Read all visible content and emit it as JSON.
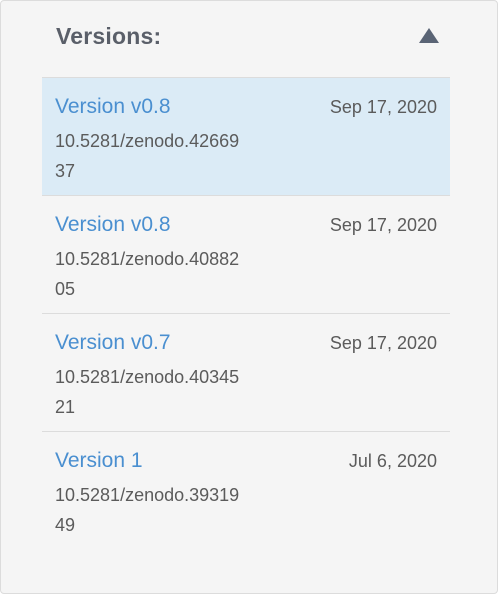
{
  "header": {
    "title": "Versions:",
    "toggle_icon": "triangle-up-icon"
  },
  "versions": [
    {
      "label": "Version v0.8",
      "date": "Sep 17, 2020",
      "doi": "10.5281/zenodo.4266937",
      "selected": true
    },
    {
      "label": "Version v0.8",
      "date": "Sep 17, 2020",
      "doi": "10.5281/zenodo.4088205",
      "selected": false
    },
    {
      "label": "Version v0.7",
      "date": "Sep 17, 2020",
      "doi": "10.5281/zenodo.4034521",
      "selected": false
    },
    {
      "label": "Version 1",
      "date": "Jul 6, 2020",
      "doi": "10.5281/zenodo.3931949",
      "selected": false
    }
  ],
  "colors": {
    "panel_bg": "#f5f5f5",
    "selected_bg": "#dbebf6",
    "link": "#4a8fd0",
    "title": "#5a5f69",
    "text": "#5b5b5b"
  }
}
